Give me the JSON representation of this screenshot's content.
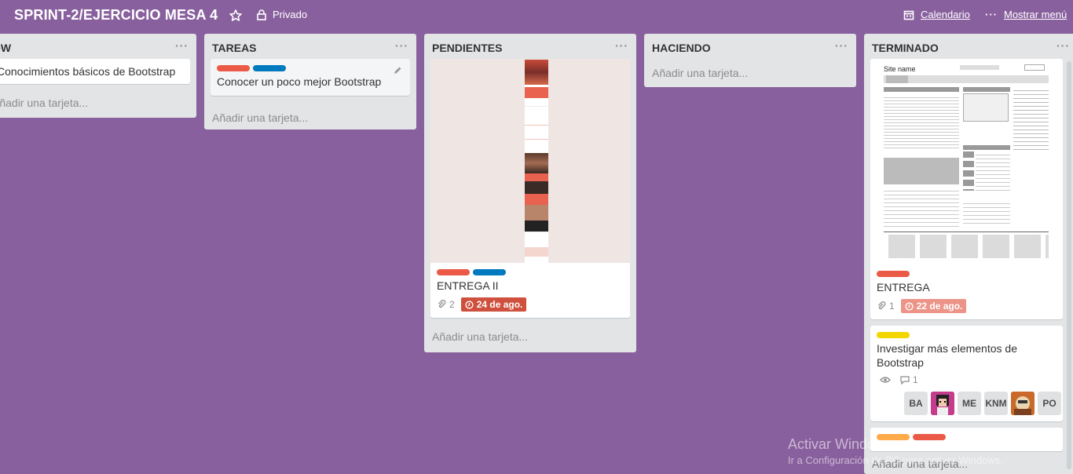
{
  "header": {
    "board_title": "SPRINT-2/EJERCICIO MESA 4",
    "privacy": "Privado",
    "calendar": "Calendario",
    "show_menu": "Mostrar menú"
  },
  "lists": [
    {
      "name": "OW",
      "cards": [
        {
          "title": "Conocimientos básicos de Bootstrap"
        }
      ],
      "add_card": "Añadir una tarjeta..."
    },
    {
      "name": "TAREAS",
      "cards": [
        {
          "title": "Conocer un poco mejor Bootstrap",
          "labels": [
            "#eb5a46",
            "#0079bf"
          ]
        }
      ],
      "add_card": "Añadir una tarjeta..."
    },
    {
      "name": "PENDIENTES",
      "cards": [
        {
          "title": "ENTREGA II",
          "labels": [
            "#eb5a46",
            "#0079bf"
          ],
          "attachments": "2",
          "due": "24 de ago.",
          "due_color": "#cf513d"
        }
      ],
      "add_card": "Añadir una tarjeta..."
    },
    {
      "name": "HACIENDO",
      "cards": [],
      "add_card": "Añadir una tarjeta..."
    },
    {
      "name": "TERMINADO",
      "cards": [
        {
          "title": "ENTREGA",
          "labels": [
            "#eb5a46"
          ],
          "attachments": "1",
          "due": "22 de ago.",
          "due_color": "#ec9488",
          "cover": {
            "site_name": "Site name"
          }
        },
        {
          "title": "Investigar más elementos de Bootstrap",
          "labels": [
            "#f2d600"
          ],
          "comments": "1",
          "members": [
            "BA",
            "",
            "ME",
            "KNM",
            "",
            "PO"
          ]
        },
        {
          "labels": [
            "#ffab4a",
            "#eb5a46"
          ]
        }
      ],
      "add_card": "Añadir una tarjeta..."
    }
  ],
  "watermark": {
    "line1": "Activar Windows",
    "line2": "Ir a Configuración de PC para activar Windows."
  }
}
